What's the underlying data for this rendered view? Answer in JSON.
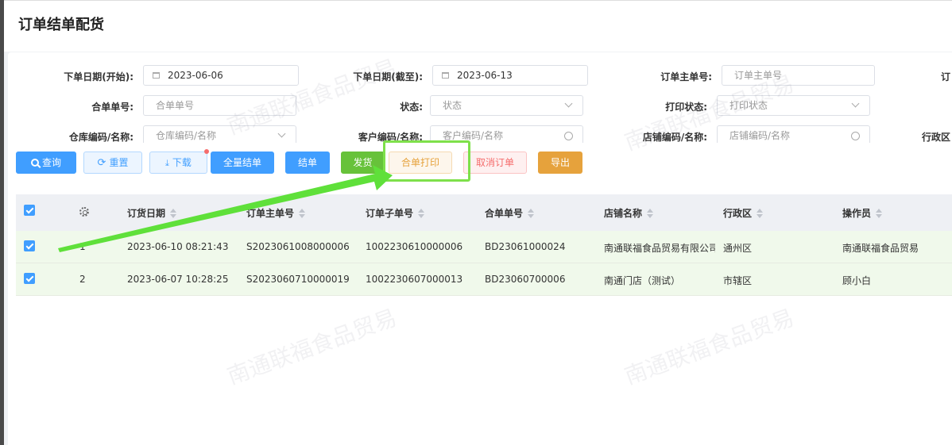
{
  "page": {
    "title": "订单结单配货"
  },
  "filters": {
    "start_date": {
      "label": "下单日期(开始):",
      "value": "2023-06-06"
    },
    "end_date": {
      "label": "下单日期(截至):",
      "value": "2023-06-13"
    },
    "order_main_no": {
      "label": "订单主单号:",
      "placeholder": "订单主单号"
    },
    "merge_no": {
      "label": "合单单号:",
      "placeholder": "合单单号"
    },
    "status": {
      "label": "状态:",
      "placeholder": "状态"
    },
    "print_status": {
      "label": "打印状态:",
      "placeholder": "打印状态"
    },
    "warehouse": {
      "label": "仓库编码/名称:",
      "placeholder": "仓库编码/名称"
    },
    "customer": {
      "label": "客户编码/名称:",
      "placeholder": "客户编码/名称"
    },
    "store": {
      "label": "店铺编码/名称:",
      "placeholder": "店铺编码/名称"
    },
    "district": {
      "label": "行政区"
    }
  },
  "toolbar": {
    "query": "查询",
    "reset": "重置",
    "download": "下载",
    "close_all": "全量结单",
    "close": "结单",
    "ship": "发货",
    "merge_print": "合单打印",
    "cancel_order": "取消订单",
    "export": "导出"
  },
  "table": {
    "columns": [
      "订货日期",
      "订单主单号",
      "订单子单号",
      "合单单号",
      "店铺名称",
      "行政区",
      "操作员"
    ],
    "rows": [
      {
        "index": "1",
        "date": "2023-06-10 08:21:43",
        "main_no": "S2023061008000006",
        "sub_no": "1002230610000006",
        "merge_no": "BD23061000024",
        "store": "南通联福食品贸易有限公司",
        "district": "通州区",
        "operator": "南通联福食品贸易"
      },
      {
        "index": "2",
        "date": "2023-06-07 10:28:25",
        "main_no": "S2023060710000019",
        "sub_no": "1002230607000013",
        "merge_no": "BD23060700006",
        "store": "南通门店（测试）",
        "district": "市辖区",
        "operator": "顾小白"
      }
    ]
  },
  "watermark": {
    "text": "南通联福食品贸易"
  },
  "colors": {
    "primary": "#409eff",
    "success": "#67c23a",
    "warning": "#e6a23c",
    "danger": "#f56c6c",
    "annotation": "#7ee04a"
  }
}
